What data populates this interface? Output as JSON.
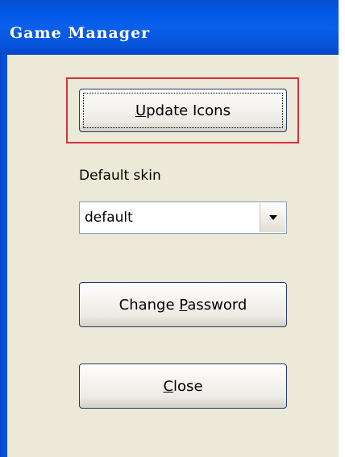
{
  "window": {
    "title": "Game Manager"
  },
  "buttons": {
    "update_icons": {
      "before": "",
      "accel": "U",
      "after": "pdate Icons"
    },
    "change_password": {
      "before": "Change ",
      "accel": "P",
      "after": "assword"
    },
    "close": {
      "before": "",
      "accel": "C",
      "after": "lose"
    }
  },
  "skin": {
    "label": "Default skin",
    "selected": "default"
  },
  "colors": {
    "titlebar": "#0058e6",
    "client_bg": "#ece9d8",
    "highlight_border": "#d6313d"
  },
  "icons": {
    "dropdown": "chevron-down-icon"
  }
}
